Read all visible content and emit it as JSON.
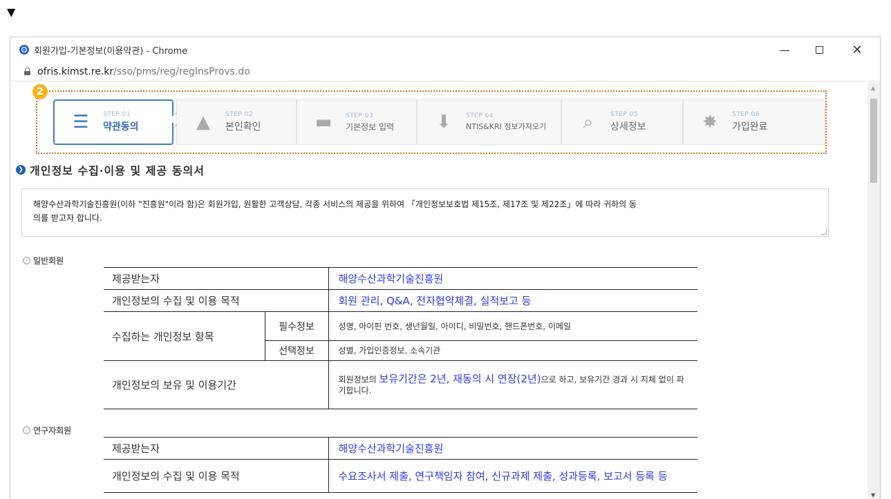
{
  "top_marker": "▼",
  "window": {
    "title": "회원가입-기본정보(이용약관) - Chrome",
    "controls": {
      "minimize": "—",
      "close": "✕"
    }
  },
  "address": {
    "host": "ofris.kimst.re.kr",
    "path": "/sso/pms/reg/regInsProvs.do"
  },
  "steps_badge": "2",
  "steps": [
    {
      "no": "STEP 01",
      "name": "약관동의",
      "icon": "checklist-icon"
    },
    {
      "no": "STEP 02",
      "name": "본인확인",
      "icon": "warning-icon"
    },
    {
      "no": "STEP 03",
      "name": "기본정보 입력",
      "icon": "edit-icon"
    },
    {
      "no": "STEP 04",
      "name": "NTIS&KRI 정보가져오기",
      "icon": "download-icon"
    },
    {
      "no": "STEP 05",
      "name": "상세정보",
      "icon": "search-doc-icon"
    },
    {
      "no": "STEP 06",
      "name": "가입완료",
      "icon": "star-badge-icon"
    }
  ],
  "section": {
    "title": "개인정보 수집·이용 및 제공 동의서",
    "agreement_line1": "해양수산과학기술진흥원(이하 \"진흥원\"이라 함)은 회원가입, 원활한 고객상담, 각종 서비스의 제공을 위하여 「개인정보보호법 제15조, 제17조 및 제22조」에 따라 귀하의 동",
    "agreement_line2": "의를 받고자 합니다."
  },
  "general": {
    "heading": "일반회원",
    "r1_label": "제공받는자",
    "r1_value": "해양수산과학기술진흥원",
    "r2_label": "개인정보의 수집 및 이용 목적",
    "r2_value": "회원 관리, Q&A, 전자협약체결, 실적보고 등",
    "r3_label": "수집하는 개인정보 항목",
    "r3_sub1": "필수정보",
    "r3_val1": "성명, 아이핀 번호, 생년월일, 아이디, 비밀번호, 핸드폰번호, 이메일",
    "r3_sub2": "선택정보",
    "r3_val2": "성별, 가입인증정보, 소속기관",
    "r4_label": "개인정보의 보유 및 이용기간",
    "r4_pre": "회원정보의 ",
    "r4_hl": "보유기간은 2년, 재동의 시 연장(2년)",
    "r4_post": "으로 하고, 보유기간 경과 시 지체 없이 파기합니다."
  },
  "researcher": {
    "heading": "연구자회원",
    "r1_label": "제공받는자",
    "r1_value": "해양수산과학기술진흥원",
    "r2_label": "개인정보의 수집 및 이용 목적",
    "r2_value": "수요조사서 제출, 연구책임자 참여, 신규과제 제출, 성과등록, 보고서 등록 등"
  }
}
